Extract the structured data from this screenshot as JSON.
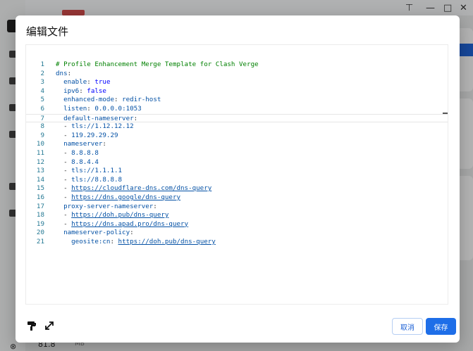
{
  "background": {
    "traffic_value": "81.8",
    "traffic_unit": "MB",
    "window_controls": [
      "pin-icon",
      "minimize-icon",
      "maximize-icon",
      "close-icon"
    ]
  },
  "dialog": {
    "title": "编辑文件",
    "editor": {
      "active_line": 7,
      "lines": [
        {
          "n": "1",
          "tokens": [
            [
              "c",
              "# Profile Enhancement Merge Template for Clash Verge"
            ]
          ]
        },
        {
          "n": "2",
          "tokens": [
            [
              "k",
              "dns"
            ],
            [
              "p",
              ":"
            ]
          ]
        },
        {
          "n": "3",
          "tokens": [
            [
              "k",
              "  enable"
            ],
            [
              "p",
              ": "
            ],
            [
              "b",
              "true"
            ]
          ]
        },
        {
          "n": "4",
          "tokens": [
            [
              "k",
              "  ipv6"
            ],
            [
              "p",
              ": "
            ],
            [
              "b",
              "false"
            ]
          ]
        },
        {
          "n": "5",
          "tokens": [
            [
              "k",
              "  enhanced-mode"
            ],
            [
              "p",
              ": "
            ],
            [
              "s",
              "redir-host"
            ]
          ]
        },
        {
          "n": "6",
          "tokens": [
            [
              "k",
              "  listen"
            ],
            [
              "p",
              ": "
            ],
            [
              "s",
              "0.0.0.0:1053"
            ]
          ]
        },
        {
          "n": "7",
          "tokens": [
            [
              "k",
              "  default-nameserver"
            ],
            [
              "p",
              ":"
            ]
          ]
        },
        {
          "n": "8",
          "tokens": [
            [
              "p",
              "  - "
            ],
            [
              "s",
              "tls://1.12.12.12"
            ]
          ]
        },
        {
          "n": "9",
          "tokens": [
            [
              "p",
              "  - "
            ],
            [
              "s",
              "119.29.29.29"
            ]
          ]
        },
        {
          "n": "10",
          "tokens": [
            [
              "k",
              "  nameserver"
            ],
            [
              "p",
              ":"
            ]
          ]
        },
        {
          "n": "11",
          "tokens": [
            [
              "p",
              "  - "
            ],
            [
              "s",
              "8.8.8.8"
            ]
          ]
        },
        {
          "n": "12",
          "tokens": [
            [
              "p",
              "  - "
            ],
            [
              "s",
              "8.8.4.4"
            ]
          ]
        },
        {
          "n": "13",
          "tokens": [
            [
              "p",
              "  - "
            ],
            [
              "s",
              "tls://1.1.1.1"
            ]
          ]
        },
        {
          "n": "14",
          "tokens": [
            [
              "p",
              "  - "
            ],
            [
              "s",
              "tls://8.8.8.8"
            ]
          ]
        },
        {
          "n": "15",
          "tokens": [
            [
              "p",
              "  - "
            ],
            [
              "l",
              "https://cloudflare-dns.com/dns-query"
            ]
          ]
        },
        {
          "n": "16",
          "tokens": [
            [
              "p",
              "  - "
            ],
            [
              "l",
              "https://dns.google/dns-query"
            ]
          ]
        },
        {
          "n": "17",
          "tokens": [
            [
              "k",
              "  proxy-server-nameserver"
            ],
            [
              "p",
              ":"
            ]
          ]
        },
        {
          "n": "18",
          "tokens": [
            [
              "p",
              "  - "
            ],
            [
              "l",
              "https://doh.pub/dns-query"
            ]
          ]
        },
        {
          "n": "19",
          "tokens": [
            [
              "p",
              "  - "
            ],
            [
              "l",
              "https://dns.apad.pro/dns-query"
            ]
          ]
        },
        {
          "n": "20",
          "tokens": [
            [
              "k",
              "  nameserver-policy"
            ],
            [
              "p",
              ":"
            ]
          ]
        },
        {
          "n": "21",
          "tokens": [
            [
              "k",
              "    geosite:cn"
            ],
            [
              "p",
              ": "
            ],
            [
              "l",
              "https://doh.pub/dns-query"
            ]
          ]
        }
      ]
    },
    "footer": {
      "format_icon": "paint-roller-icon",
      "expand_icon": "expand-icon",
      "cancel_label": "取消",
      "save_label": "保存"
    }
  }
}
